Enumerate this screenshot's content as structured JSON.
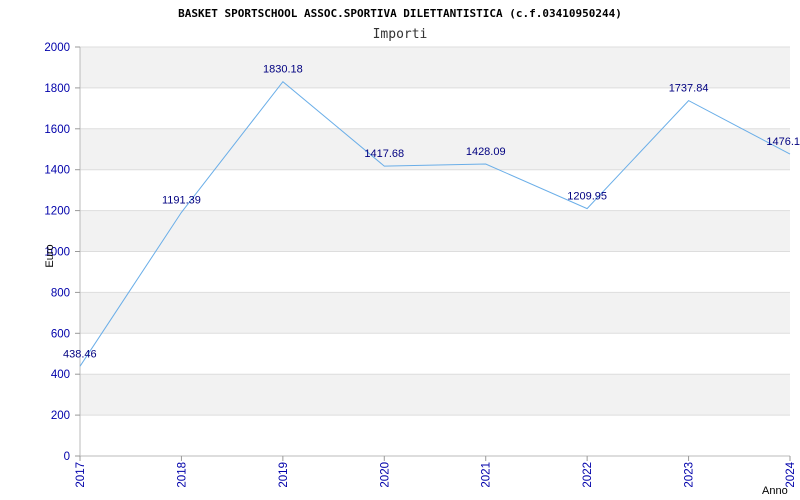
{
  "chart_data": {
    "type": "line",
    "title": "BASKET SPORTSCHOOL ASSOC.SPORTIVA DILETTANTISTICA (c.f.03410950244)",
    "subtitle": "Importi",
    "xlabel": "Anno",
    "ylabel": "Euro",
    "categories": [
      "2017",
      "2018",
      "2019",
      "2020",
      "2021",
      "2022",
      "2023",
      "2024"
    ],
    "series": [
      {
        "values": [
          438.46,
          1191.39,
          1830.18,
          1417.68,
          1428.09,
          1209.95,
          1737.84,
          1476.1
        ],
        "labels": [
          "438.46",
          "1191.39",
          "1830.18",
          "1417.68",
          "1428.09",
          "1209.95",
          "1737.84",
          "1476.1"
        ]
      }
    ],
    "yticks": [
      "0",
      "200",
      "400",
      "600",
      "800",
      "1000",
      "1200",
      "1400",
      "1600",
      "1800",
      "2000"
    ],
    "ylim": [
      0,
      2000
    ],
    "grid": true,
    "colors": {
      "line": "#6aaee8",
      "band": "#f2f2f2",
      "gridline": "#dddddd",
      "tick": "#0000aa",
      "data_label": "#000080"
    }
  }
}
